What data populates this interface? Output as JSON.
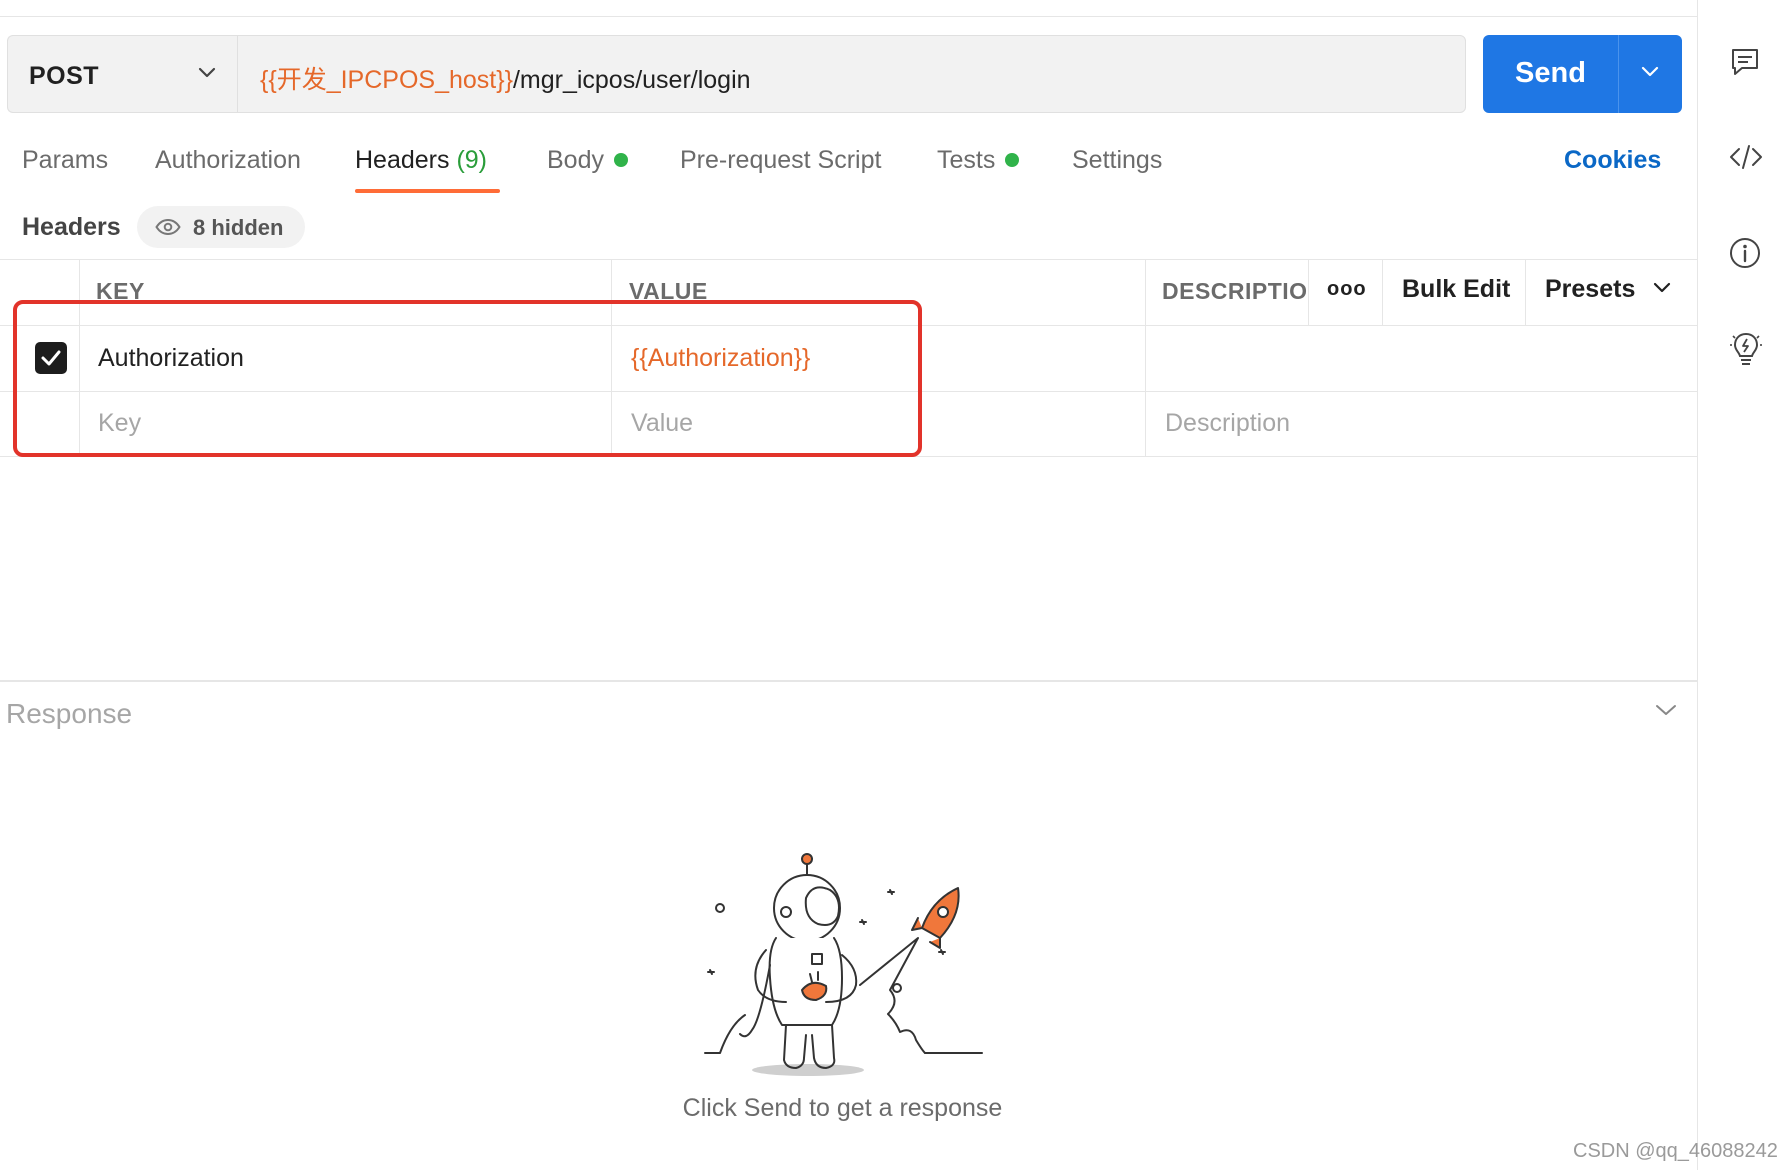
{
  "request": {
    "method": "POST",
    "url_variable": "{{开发_IPCPOS_host}}",
    "url_path": "/mgr_icpos/user/login",
    "send_label": "Send"
  },
  "tabs": [
    {
      "label": "Params"
    },
    {
      "label": "Authorization"
    },
    {
      "label": "Headers",
      "count": "(9)",
      "active": true
    },
    {
      "label": "Body",
      "indicator": "green-dot"
    },
    {
      "label": "Pre-request Script"
    },
    {
      "label": "Tests",
      "indicator": "green-dot"
    },
    {
      "label": "Settings"
    }
  ],
  "cookies_label": "Cookies",
  "headers_section": {
    "title": "Headers",
    "hidden_label": "8 hidden"
  },
  "table": {
    "columns": {
      "key": "KEY",
      "value": "VALUE",
      "description": "DESCRIPTIO"
    },
    "more_label": "ooo",
    "bulk_edit_label": "Bulk Edit",
    "presets_label": "Presets",
    "rows": [
      {
        "checked": true,
        "key": "Authorization",
        "value": "{{Authorization}}",
        "description": ""
      }
    ],
    "placeholders": {
      "key": "Key",
      "value": "Value",
      "description": "Description"
    }
  },
  "response": {
    "title": "Response",
    "empty_message": "Click Send to get a response"
  },
  "right_rail_icons": [
    "comment-icon",
    "code-icon",
    "info-icon",
    "lightbulb-icon"
  ],
  "watermark": "CSDN @qq_46088242",
  "colors": {
    "accent": "#ff6c37",
    "send_button": "#1f77e4",
    "variable_text": "#e5682a",
    "status_dot": "#30b34a",
    "highlight_box": "#e2332a",
    "link": "#0b68c6"
  }
}
